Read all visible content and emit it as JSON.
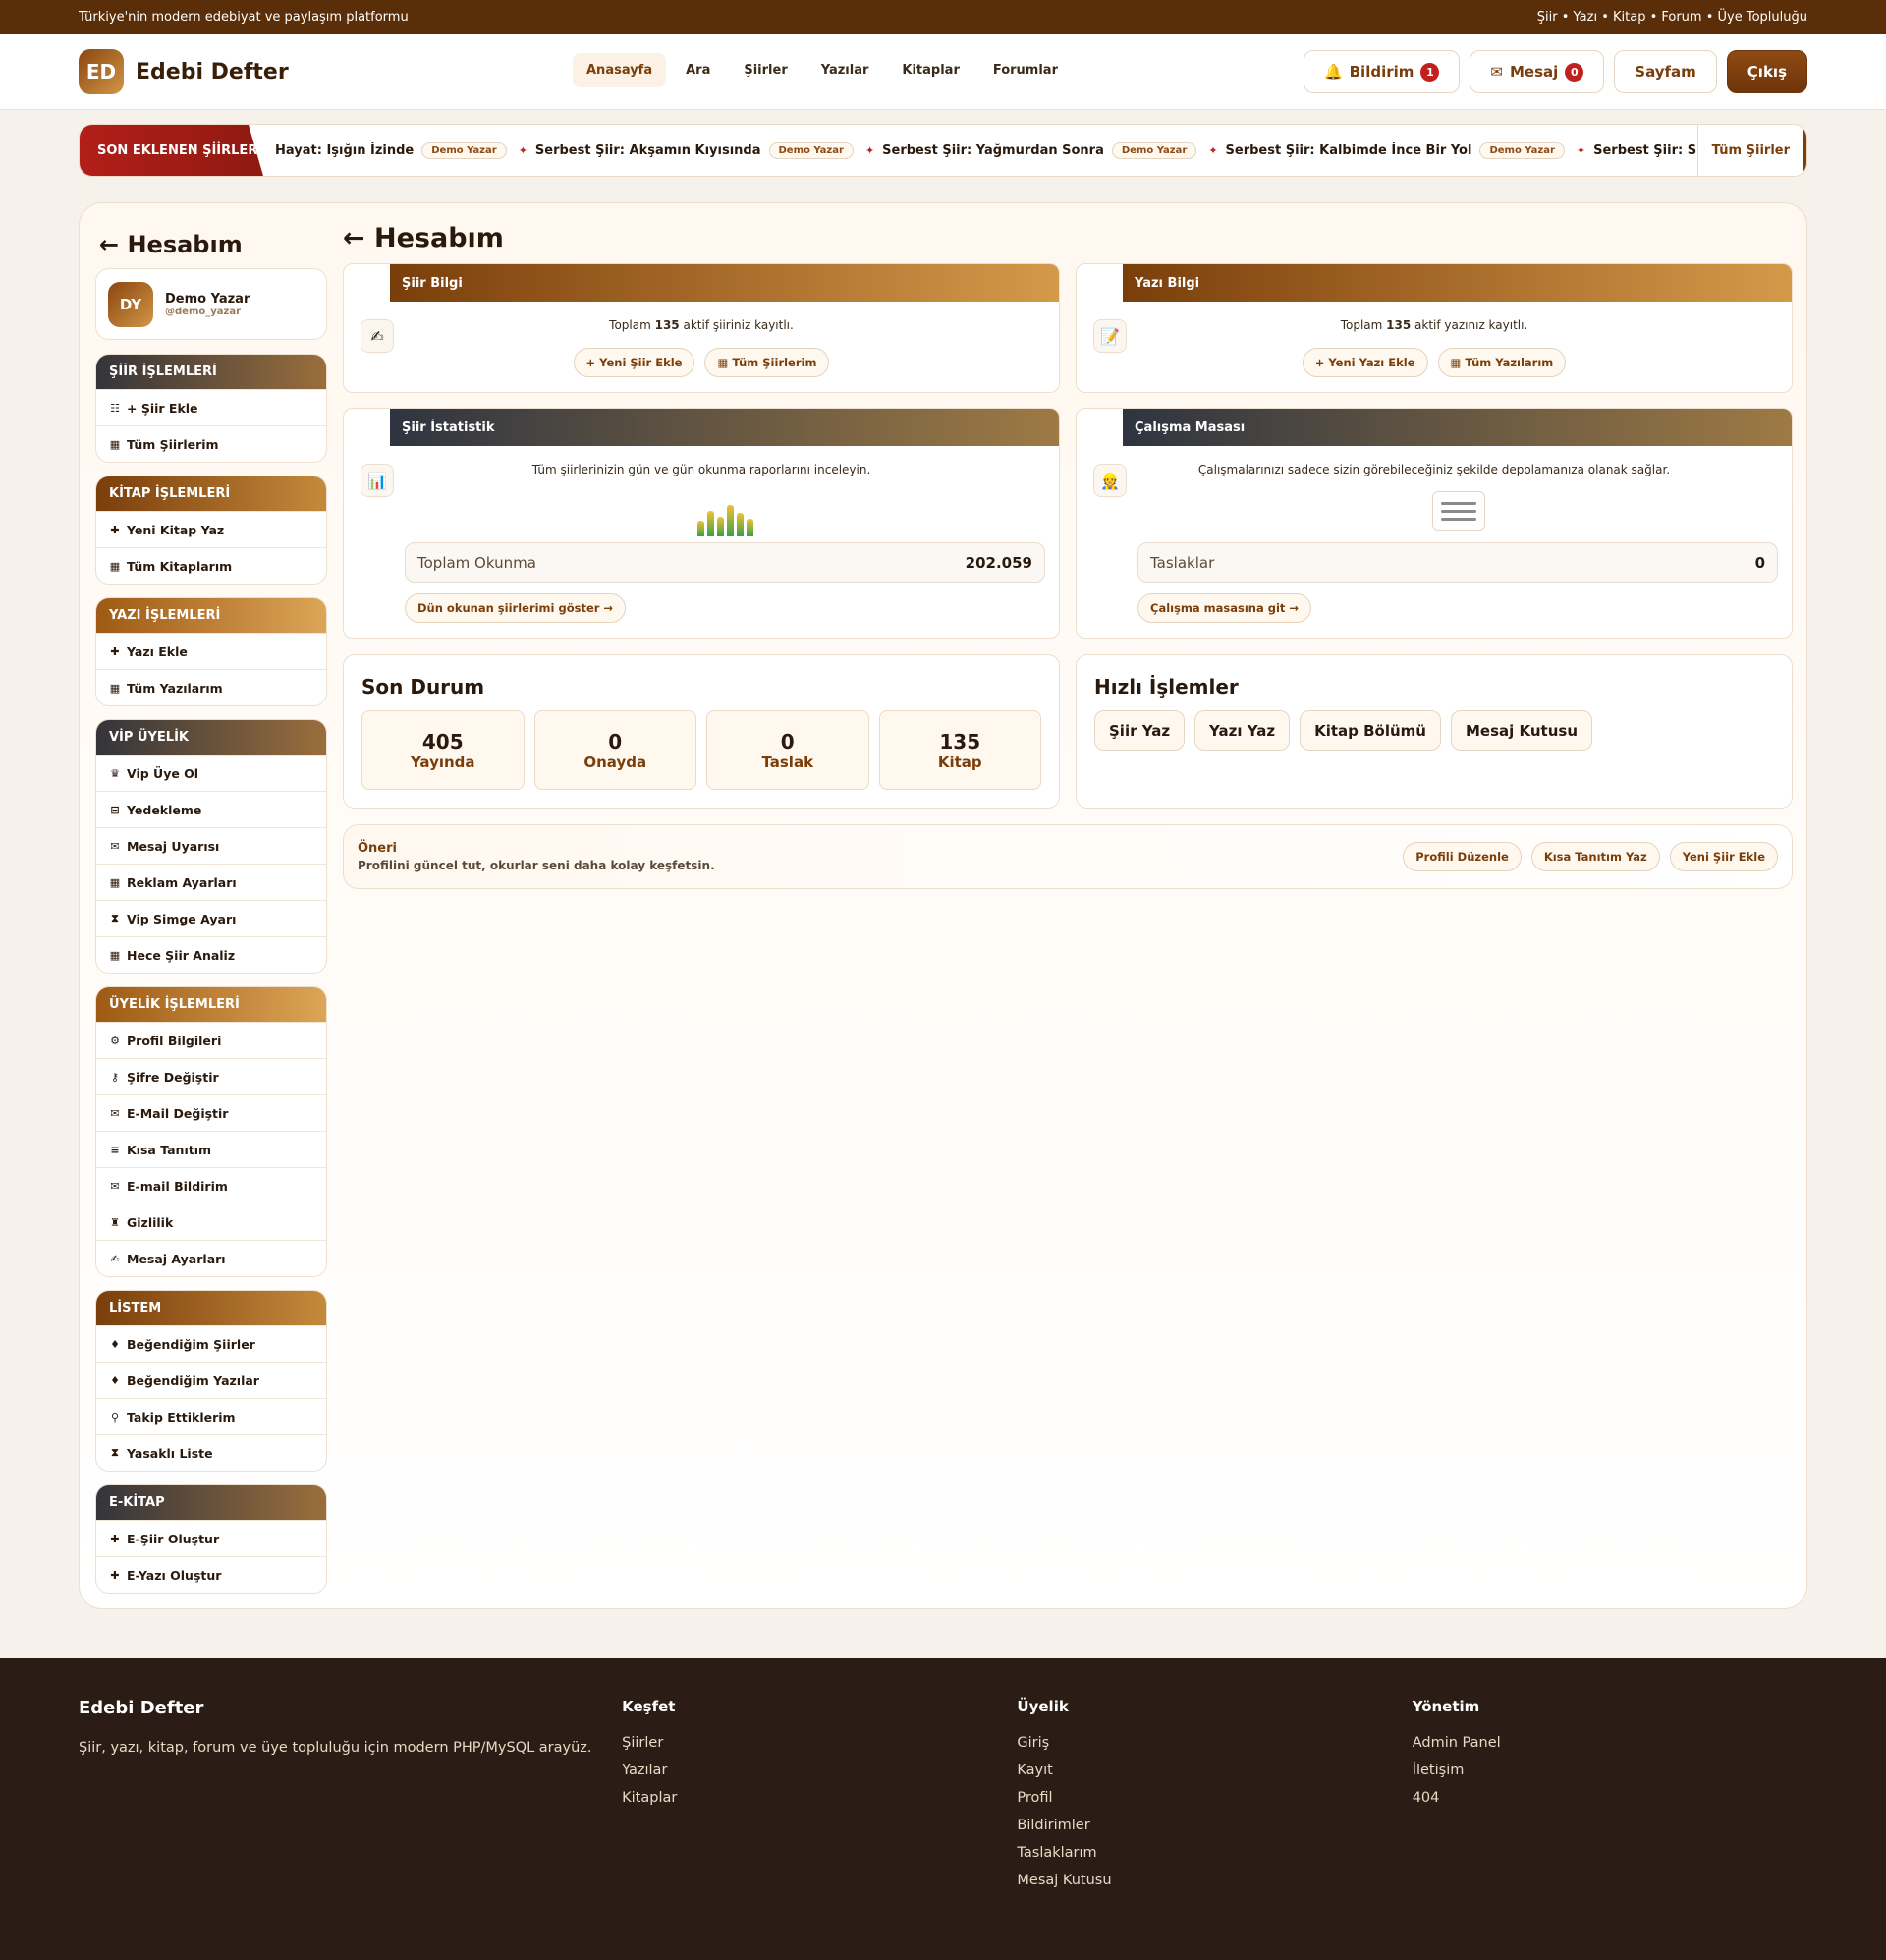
{
  "topbar": {
    "left": "Türkiye'nin modern edebiyat ve paylaşım platformu",
    "right": "Şiir • Yazı • Kitap • Forum • Üye Topluluğu"
  },
  "brand": {
    "logo": "ED",
    "name": "Edebi Defter"
  },
  "nav": [
    {
      "label": "Anasayfa"
    },
    {
      "label": "Ara"
    },
    {
      "label": "Şiirler"
    },
    {
      "label": "Yazılar"
    },
    {
      "label": "Kitaplar"
    },
    {
      "label": "Forumlar"
    }
  ],
  "header": {
    "notif_icon": "🔔",
    "notif_label": "Bildirim",
    "notif_count": "1",
    "msg_icon": "✉",
    "msg_label": "Mesaj",
    "msg_count": "0",
    "page_label": "Sayfam",
    "logout_label": "Çıkış"
  },
  "ticker": {
    "label": "SON EKLENEN ŞİİRLER",
    "items": [
      {
        "star": "",
        "title": "Hayat: Işığın İzinde",
        "author": "Demo Yazar"
      },
      {
        "star": "✦",
        "title": "Serbest Şiir: Akşamın Kıyısında",
        "author": "Demo Yazar"
      },
      {
        "star": "✦",
        "title": "Serbest Şiir: Yağmurdan Sonra",
        "author": "Demo Yazar"
      },
      {
        "star": "✦",
        "title": "Serbest Şiir: Kalbimde İnce Bir Yol",
        "author": "Demo Yazar"
      },
      {
        "star": "✦",
        "title": "Serbest Şiir: S",
        "author": ""
      }
    ],
    "all_label": "Tüm Şiirler"
  },
  "sidebar": {
    "title": "← Hesabım",
    "user": {
      "initials": "DY",
      "name": "Demo Yazar",
      "handle": "@demo_yazar"
    },
    "groups": [
      {
        "title": "ŞİİR İŞLEMLERİ",
        "items": [
          {
            "icon": "☷",
            "label": "+ Şiir Ekle"
          },
          {
            "icon": "▦",
            "label": "Tüm Şiirlerim"
          }
        ]
      },
      {
        "title": "KİTAP İŞLEMLERİ",
        "items": [
          {
            "icon": "✚",
            "label": "Yeni Kitap Yaz"
          },
          {
            "icon": "▦",
            "label": "Tüm Kitaplarım"
          }
        ]
      },
      {
        "title": "YAZI İŞLEMLERİ",
        "items": [
          {
            "icon": "✚",
            "label": "Yazı Ekle"
          },
          {
            "icon": "▦",
            "label": "Tüm Yazılarım"
          }
        ]
      },
      {
        "title": "VİP ÜYELİK",
        "items": [
          {
            "icon": "♛",
            "label": "Vip Üye Ol"
          },
          {
            "icon": "⊟",
            "label": "Yedekleme"
          },
          {
            "icon": "✉",
            "label": "Mesaj Uyarısı"
          },
          {
            "icon": "▦",
            "label": "Reklam Ayarları"
          },
          {
            "icon": "⧗",
            "label": "Vip Simge Ayarı"
          },
          {
            "icon": "▦",
            "label": "Hece Şiir Analiz"
          }
        ]
      },
      {
        "title": "ÜYELİK İŞLEMLERİ",
        "items": [
          {
            "icon": "⚙",
            "label": "Profil Bilgileri"
          },
          {
            "icon": "⚷",
            "label": "Şifre Değiştir"
          },
          {
            "icon": "✉",
            "label": "E-Mail Değiştir"
          },
          {
            "icon": "≡",
            "label": "Kısa Tanıtım"
          },
          {
            "icon": "✉",
            "label": "E-mail Bildirim"
          },
          {
            "icon": "♜",
            "label": "Gizlilik"
          },
          {
            "icon": "✍",
            "label": "Mesaj Ayarları"
          }
        ]
      },
      {
        "title": "LİSTEM",
        "items": [
          {
            "icon": "♦",
            "label": "Beğendiğim Şiirler"
          },
          {
            "icon": "♦",
            "label": "Beğendiğim Yazılar"
          },
          {
            "icon": "⚲",
            "label": "Takip Ettiklerim"
          },
          {
            "icon": "⧗",
            "label": "Yasaklı Liste"
          }
        ]
      },
      {
        "title": "E-KİTAP",
        "items": [
          {
            "icon": "✚",
            "label": "E-Şiir Oluştur"
          },
          {
            "icon": "✚",
            "label": "E-Yazı Oluştur"
          }
        ]
      }
    ]
  },
  "main": {
    "title": "← Hesabım",
    "siir_bilgi": {
      "title": "Şiir Bilgi",
      "icon": "✍",
      "desc_pre": "Toplam ",
      "count": "135",
      "desc_post": " aktif şiiriniz kayıtlı.",
      "btn_add": "+ Yeni Şiir Ekle",
      "btn_all": "▦ Tüm Şiirlerim"
    },
    "yazi_bilgi": {
      "title": "Yazı Bilgi",
      "icon": "📝",
      "desc_pre": "Toplam ",
      "count": "135",
      "desc_post": " aktif yazınız kayıtlı.",
      "btn_add": "+ Yeni Yazı Ekle",
      "btn_all": "▦ Tüm Yazılarım"
    },
    "siir_istatistik": {
      "title": "Şiir İstatistik",
      "icon": "📊",
      "desc": "Tüm şiirlerinizin gün ve gün okunma raporlarını inceleyin.",
      "metric_label": "Toplam Okunma",
      "metric_value": "202.059",
      "link": "Dün okunan şiirlerimi göster →",
      "bars": [
        0.4,
        0.65,
        0.5,
        0.8,
        0.6,
        0.45
      ]
    },
    "calisma_masasi": {
      "title": "Çalışma Masası",
      "icon": "👷",
      "desc": "Çalışmalarınızı sadece sizin görebileceğiniz şekilde depolamanıza olanak sağlar.",
      "metric_label": "Taslaklar",
      "metric_value": "0",
      "link": "Çalışma masasına git →"
    },
    "son_durum": {
      "title": "Son Durum",
      "stats": [
        {
          "num": "405",
          "label": "Yayında"
        },
        {
          "num": "0",
          "label": "Onayda"
        },
        {
          "num": "0",
          "label": "Taslak"
        },
        {
          "num": "135",
          "label": "Kitap"
        }
      ]
    },
    "hizli": {
      "title": "Hızlı İşlemler",
      "buttons": [
        "Şiir Yaz",
        "Yazı Yaz",
        "Kitap Bölümü",
        "Mesaj Kutusu"
      ]
    },
    "oneri": {
      "title": "Öneri",
      "text": "Profilini güncel tut, okurlar seni daha kolay keşfetsin.",
      "buttons": [
        "Profili Düzenle",
        "Kısa Tanıtım Yaz",
        "Yeni Şiir Ekle"
      ]
    }
  },
  "footer": {
    "brand": "Edebi Defter",
    "text": "Şiir, yazı, kitap, forum ve üye topluluğu için modern PHP/MySQL arayüz.",
    "cols": [
      {
        "title": "Keşfet",
        "links": [
          "Şiirler",
          "Yazılar",
          "Kitaplar"
        ]
      },
      {
        "title": "Üyelik",
        "links": [
          "Giriş",
          "Kayıt",
          "Profil",
          "Bildirimler",
          "Taslaklarım",
          "Mesaj Kutusu"
        ]
      },
      {
        "title": "Yönetim",
        "links": [
          "Admin Panel",
          "İletişim",
          "404"
        ]
      }
    ]
  }
}
